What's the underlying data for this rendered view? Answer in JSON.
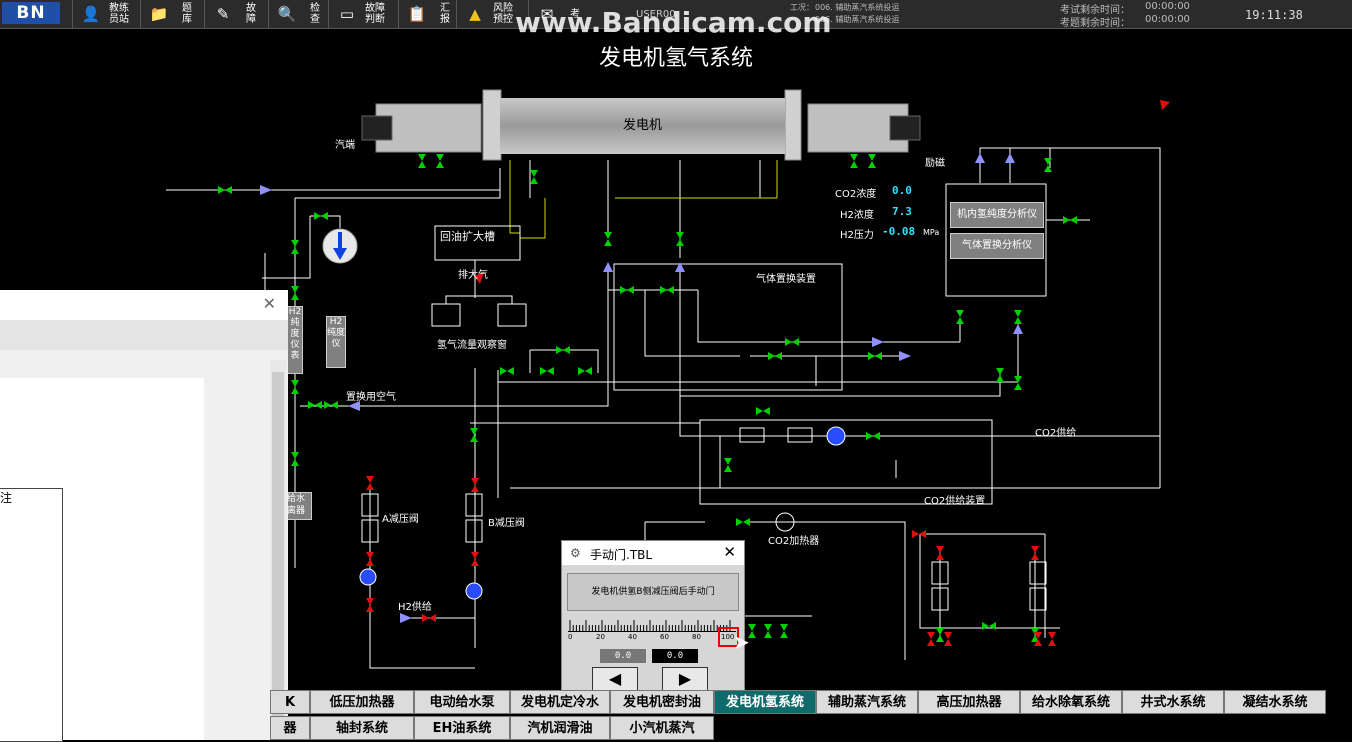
{
  "toolbar": {
    "logo": "BN",
    "buttons": [
      {
        "label": "教练\n员站",
        "icon": "user-icon"
      },
      {
        "label": "题\n库",
        "icon": "folder-icon"
      },
      {
        "label": "故\n障",
        "icon": "fault-icon"
      },
      {
        "label": "检\n查",
        "icon": "inspect-icon"
      },
      {
        "label": "故障\n判断",
        "icon": "monitor-icon"
      },
      {
        "label": "汇\n报",
        "icon": "report-icon"
      },
      {
        "label": "风险\n预控",
        "icon": "warning-icon"
      },
      {
        "label": "考",
        "icon": "exam-icon"
      }
    ],
    "user": "USER00",
    "status_work1": "工况：",
    "status_line1": "006. 辅助蒸汽系统投运",
    "status_line2": "006. 辅助蒸汽系统投运",
    "remaining_label1": "考试剩余时间：",
    "remaining_value1": "00:00:00",
    "remaining_label2": "考题剩余时间：",
    "remaining_value2": "00:00:00",
    "clock": "19:11:38",
    "watermark": "www.Bandicam.com"
  },
  "title": "发电机氢气系统",
  "labels": {
    "generator": "发电机",
    "turbine_end": "汽端",
    "exciter": "励磁",
    "oil_tank": "回油扩大槽",
    "exhaust": "排大气",
    "h2_flow_window": "氢气流量观察窗",
    "gas_replace": "气体置换装置",
    "replace_air": "置换用空气",
    "co2_supply": "CO2供给",
    "co2_supply_device": "CO2供给装置",
    "co2_heater": "CO2加热器",
    "valve_a": "A减压阀",
    "valve_b": "B减压阀",
    "h2_supply": "H2供给",
    "h2_purity_analyzer": "机内氢纯度分析仪",
    "gas_replace_analyzer": "气体置换分析仪",
    "co2_conc_label": "CO2浓度",
    "h2_conc_label": "H2浓度",
    "h2_pressure_label": "H2压力",
    "mpa": "MPa",
    "side_box1": "H2纯度仪表",
    "side_box2": "H2纯度仪",
    "side_box3": "给水\n离器"
  },
  "readings": {
    "co2_conc": "0.0",
    "h2_conc": "7.3",
    "h2_pressure": "-0.08"
  },
  "left_window": {
    "note": "注"
  },
  "dialog": {
    "title": "手动门.TBL",
    "label": "发电机供氢B侧减压阀后手动门",
    "ticks": [
      "0",
      "20",
      "40",
      "60",
      "80",
      "100"
    ],
    "value1": "0.0",
    "value2": "0.0",
    "left_arrow": "◀",
    "right_arrow": "▶"
  },
  "tabs_row1": [
    "K",
    "低压加热器",
    "电动给水泵",
    "发电机定冷水",
    "发电机密封油",
    "发电机氢系统",
    "辅助蒸汽系统",
    "高压加热器",
    "给水除氧系统",
    "井式水系统",
    "凝结水系统"
  ],
  "tabs_row2": [
    "器",
    "轴封系统",
    "EH油系统",
    "汽机润滑油",
    "小汽机蒸汽"
  ],
  "colors": {
    "pipe": "#ffffff",
    "pipe_blue": "#9090ff",
    "valve_green": "#00d000",
    "valve_red": "#e01010",
    "oil_line": "#d8d800",
    "active_tab": "#0e6b6b"
  }
}
